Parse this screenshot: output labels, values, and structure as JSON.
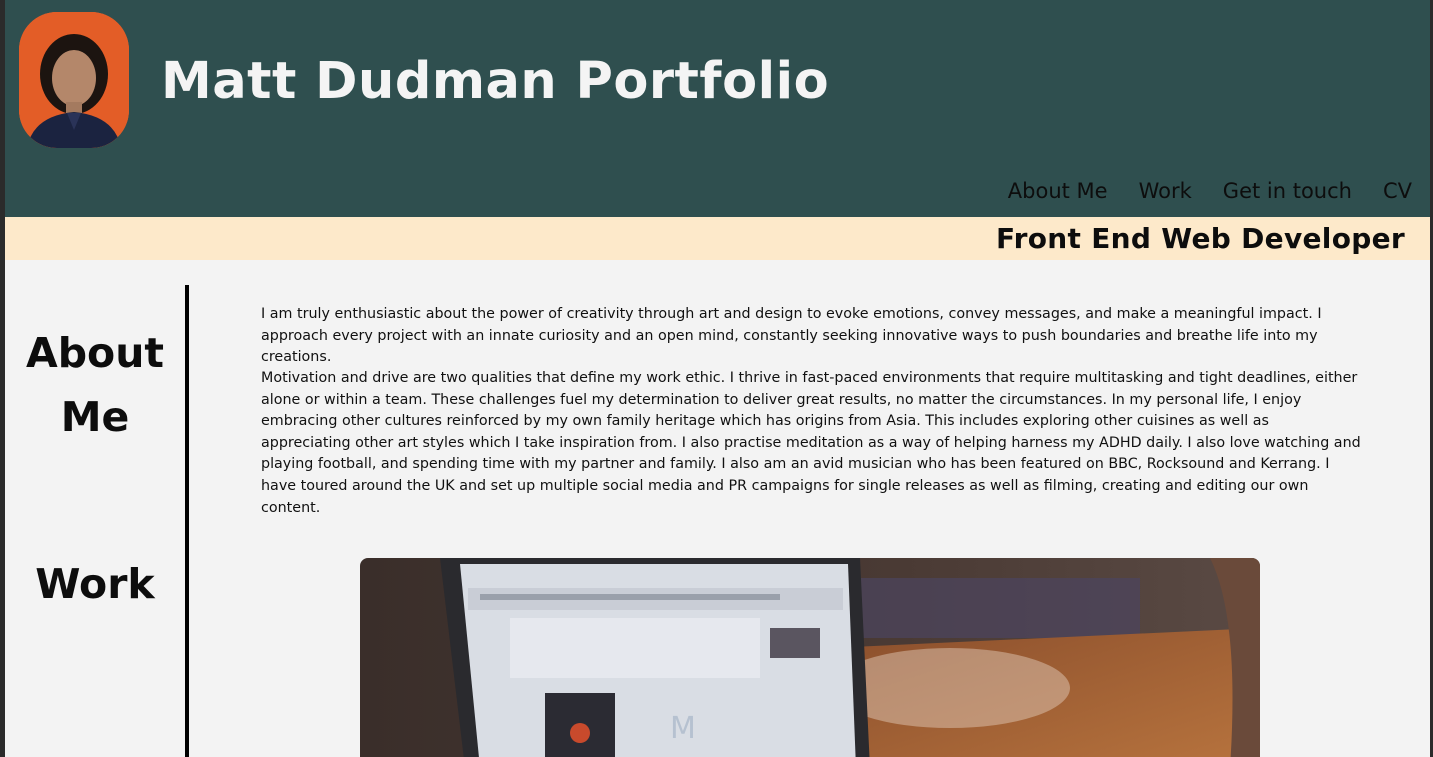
{
  "header": {
    "title": "Matt Dudman Portfolio",
    "avatar_alt": "Matt Dudman profile photo",
    "nav": [
      {
        "label": "About Me"
      },
      {
        "label": "Work"
      },
      {
        "label": "Get in touch"
      },
      {
        "label": "CV"
      }
    ]
  },
  "tagline": "Front End Web Developer",
  "sidebar": {
    "about_line1": "About",
    "about_line2": "Me",
    "work": "Work"
  },
  "about": {
    "paragraph1": "I am truly enthusiastic about the power of creativity through art and design to evoke emotions, convey messages, and make a meaningful impact. I approach every project with an innate curiosity and an open mind, constantly seeking innovative ways to push boundaries and breathe life into my creations.",
    "paragraph2": "Motivation and drive are two qualities that define my work ethic. I thrive in fast-paced environments that require multitasking and tight deadlines, either alone or within a team. These challenges fuel my determination to deliver great results, no matter the circumstances. In my personal life, I enjoy embracing other cultures reinforced by my own family heritage which has origins from Asia. This includes exploring other cuisines as well as appreciating other art styles which I take inspiration from. I also practise meditation as a way of helping harness my ADHD daily. I also love watching and playing football, and spending time with my partner and family. I also am an avid musician who has been featured on BBC, Rocksound and Kerrang. I have toured around the UK and set up multiple social media and PR campaigns for single releases as well as filming, creating and editing our own content."
  },
  "colors": {
    "header_bg": "#2f4f4f",
    "tagline_bg": "#fde9ca",
    "page_bg": "#f3f3f3"
  }
}
